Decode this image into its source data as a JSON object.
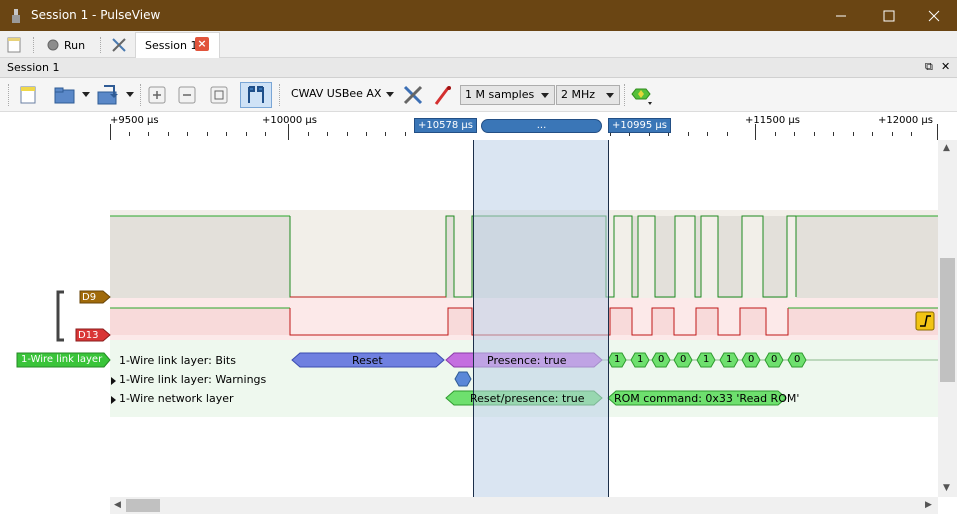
{
  "window": {
    "title": "Session 1 - PulseView"
  },
  "tabbar": {
    "run_label": "Run",
    "session_tab_label": "Session 1"
  },
  "session_header": {
    "label": "Session 1"
  },
  "toolbar": {
    "device": "CWAV USBee AX",
    "samples": "1 M samples",
    "samplerate": "2 MHz"
  },
  "ruler": {
    "ticks": [
      "+9500 µs",
      "+10000 µs",
      "+11500 µs",
      "+12000 µs"
    ],
    "cursor_left": "+10578 µs",
    "cursor_right": "+10995 µs",
    "cursor_bar": "..."
  },
  "channels": {
    "d9": "D9",
    "d13": "D13",
    "decoder_tag": "1-Wire link layer"
  },
  "rows": {
    "bits": "1-Wire link layer: Bits",
    "warnings": "1-Wire link layer: Warnings",
    "network": "1-Wire network layer"
  },
  "annotations": {
    "reset": "Reset",
    "presence": "Presence: true",
    "bits": [
      "1",
      "1",
      "0",
      "0",
      "1",
      "1",
      "0",
      "0"
    ],
    "reset_presence": "Reset/presence: true",
    "rom_command": "ROM command: 0x33 'Read ROM'"
  },
  "colors": {
    "titlebar": "#6a4513",
    "d9_tag": "#a06a0a",
    "d13_tag": "#d93636",
    "decoder_green": "#3ac43a",
    "cursor_blue": "#3a76b7",
    "reset_fill": "#6f80e0",
    "presence_fill": "#c46ee0",
    "bit_fill": "#6ee06e"
  },
  "icons": {
    "app": "pulseview-icon",
    "minimize": "minimize-icon",
    "maximize": "maximize-icon",
    "close": "close-icon"
  }
}
